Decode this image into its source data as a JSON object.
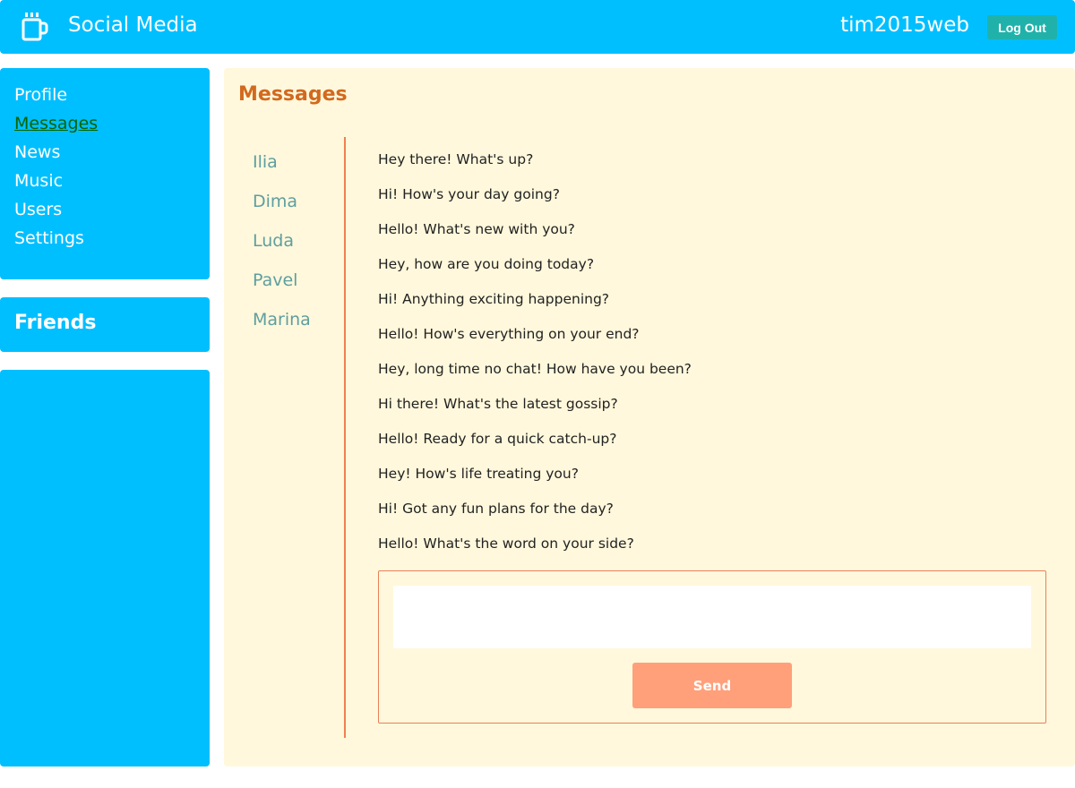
{
  "header": {
    "title": "Social Media",
    "username": "tim2015web",
    "logout_label": "Log Out",
    "logo_icon": "coffee-cup-icon"
  },
  "sidebar": {
    "items": [
      {
        "label": "Profile",
        "active": false
      },
      {
        "label": "Messages",
        "active": true
      },
      {
        "label": "News",
        "active": false
      },
      {
        "label": "Music",
        "active": false
      },
      {
        "label": "Users",
        "active": false
      },
      {
        "label": "Settings",
        "active": false
      }
    ],
    "friends_title": "Friends"
  },
  "main": {
    "title": "Messages",
    "dialogs": [
      "Ilia",
      "Dima",
      "Luda",
      "Pavel",
      "Marina"
    ],
    "messages": [
      "Hey there! What's up?",
      "Hi! How's your day going?",
      "Hello! What's new with you?",
      "Hey, how are you doing today?",
      "Hi! Anything exciting happening?",
      "Hello! How's everything on your end?",
      "Hey, long time no chat! How have you been?",
      "Hi there! What's the latest gossip?",
      "Hello! Ready for a quick catch-up?",
      "Hey! How's life treating you?",
      "Hi! Got any fun plans for the day?",
      "Hello! What's the word on your side?"
    ],
    "composer": {
      "input_value": "",
      "send_label": "Send"
    }
  },
  "colors": {
    "accent": "#00bfff",
    "page_background": "#fff8dc",
    "title": "#d2691e",
    "dialog_text": "#5f9ea0",
    "active_nav": "#006400",
    "divider": "#f08050",
    "send_button": "#ffa07a",
    "logout_button": "#20b2aa"
  }
}
